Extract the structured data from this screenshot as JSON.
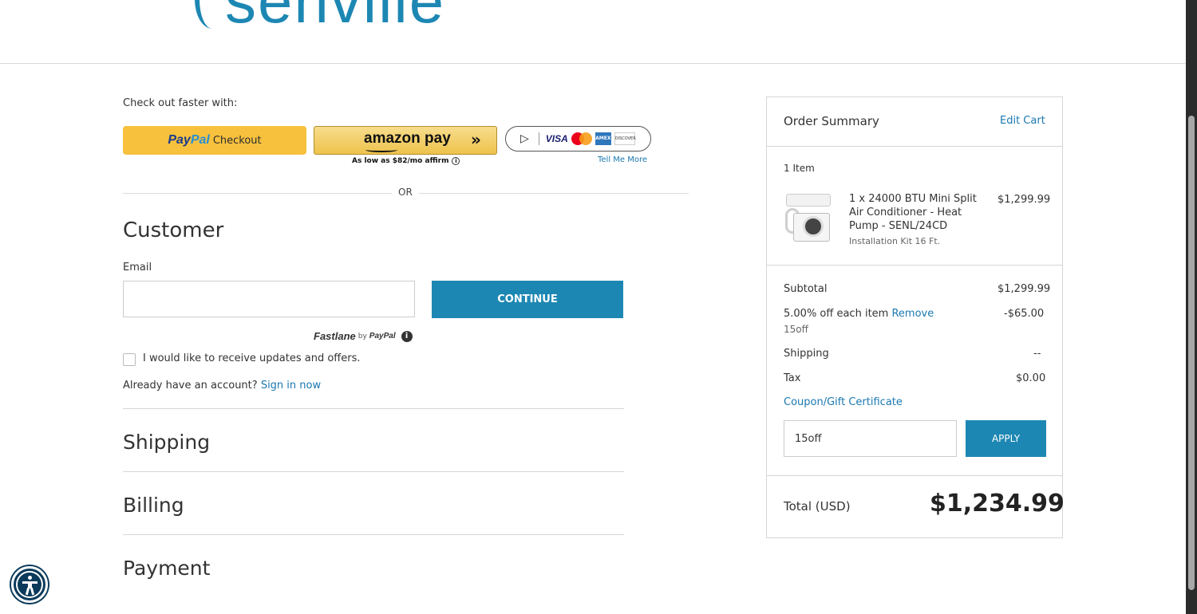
{
  "header": {
    "logo_text": "senville"
  },
  "express": {
    "title": "Check out faster with:",
    "paypal_brand_a": "Pay",
    "paypal_brand_b": "Pal",
    "paypal_label": "Checkout",
    "amazon_label": "amazon pay",
    "amazon_chevron": "»",
    "affirm_text": "As low as $82/mo",
    "affirm_brand": "affirm",
    "card_visa": "VISA",
    "card_amex": "AMEX",
    "card_discover": "DISCOVER",
    "tell_me_more": "Tell Me More",
    "or": "OR"
  },
  "customer": {
    "heading": "Customer",
    "email_label": "Email",
    "email_value": "",
    "continue_label": "CONTINUE",
    "fastlane": "Fastlane",
    "fastlane_by": "by",
    "fastlane_paypal": "PayPal",
    "updates_label": "I would like to receive updates and offers.",
    "already_text": "Already have an account?",
    "sign_in": "Sign in now"
  },
  "sections": {
    "shipping": "Shipping",
    "billing": "Billing",
    "payment": "Payment"
  },
  "summary": {
    "title": "Order Summary",
    "edit_cart": "Edit Cart",
    "item_count": "1 Item",
    "product_name": "1 x 24000 BTU Mini Split Air Conditioner - Heat Pump - SENL/24CD",
    "product_option": "Installation Kit 16 Ft.",
    "product_price": "$1,299.99",
    "subtotal_label": "Subtotal",
    "subtotal_value": "$1,299.99",
    "discount_label": "5.00% off each item",
    "discount_remove": "Remove",
    "discount_code": "15off",
    "discount_value": "-$65.00",
    "shipping_label": "Shipping",
    "shipping_value": "--",
    "tax_label": "Tax",
    "tax_value": "$0.00",
    "coupon_link": "Coupon/Gift Certificate",
    "coupon_value": "15off",
    "apply_label": "APPLY",
    "total_label": "Total (USD)",
    "total_value": "$1,234.99"
  },
  "colors": {
    "accent": "#1d87b3",
    "link": "#1a78b0",
    "paypal_yellow": "#f7c13d"
  }
}
